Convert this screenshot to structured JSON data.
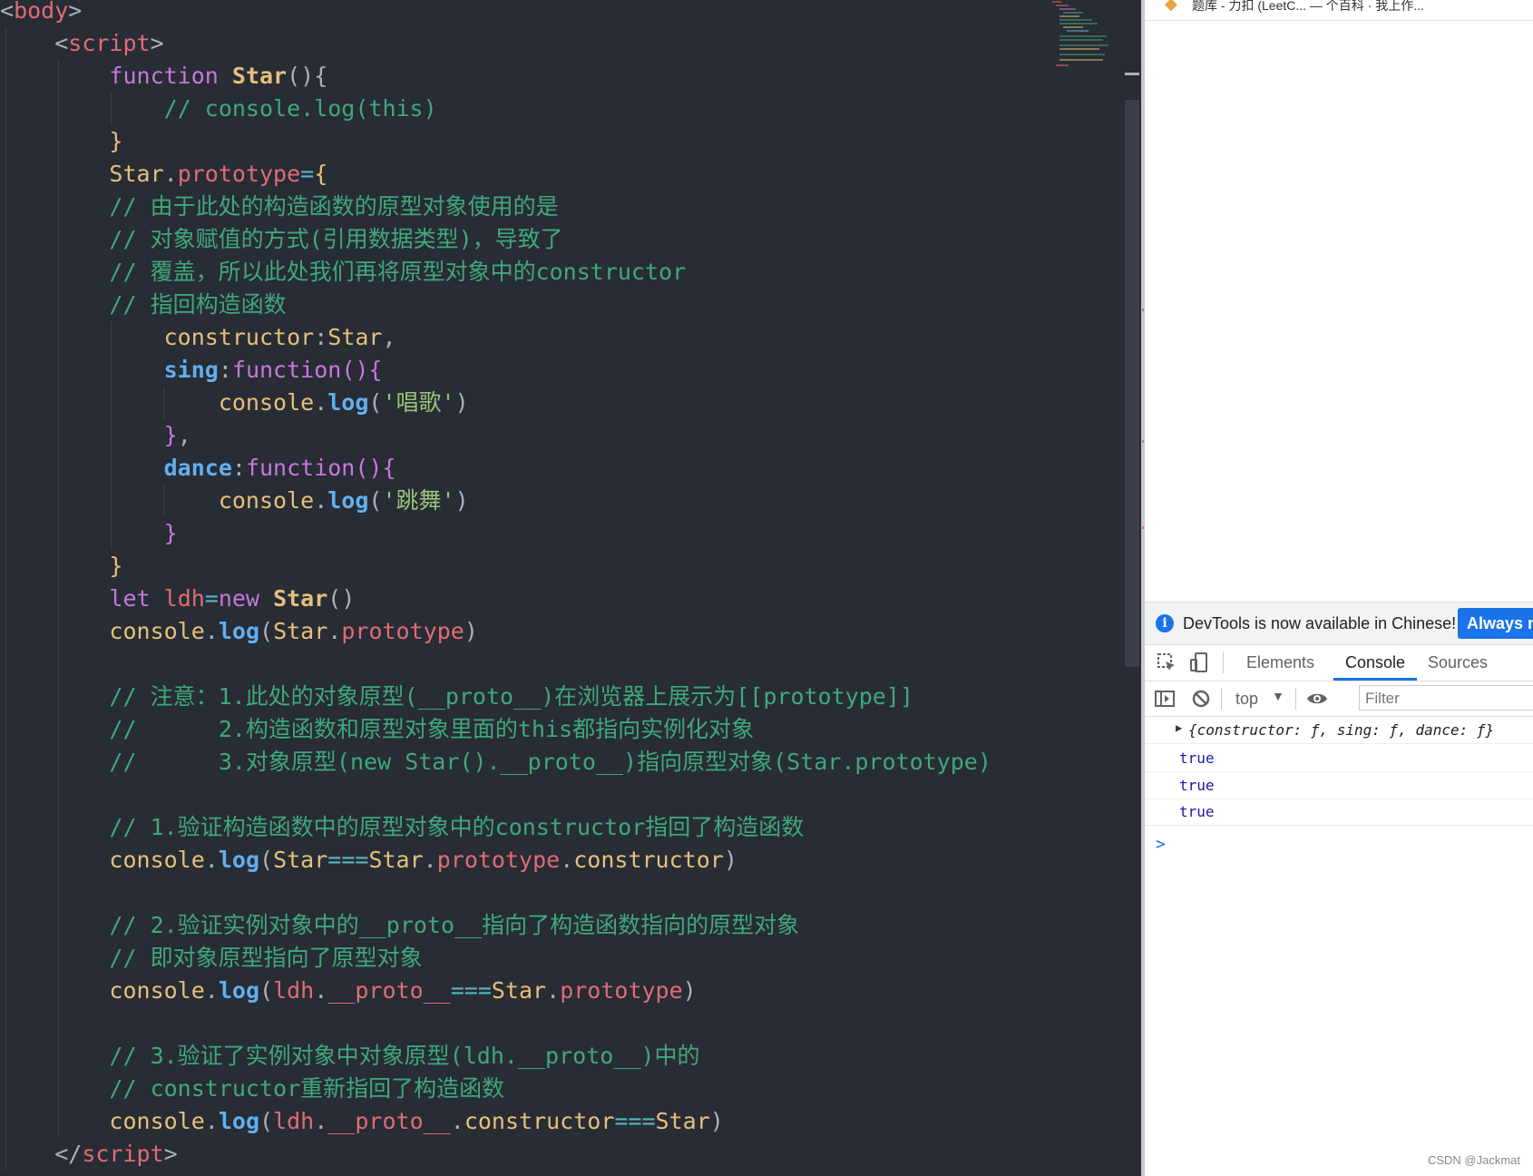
{
  "code_lines": [
    {
      "guides": [],
      "tokens": [
        [
          "t-punct",
          "<"
        ],
        [
          "t-tag",
          "body"
        ],
        [
          "t-punct",
          ">"
        ]
      ]
    },
    {
      "guides": [
        6
      ],
      "tokens": [
        [
          "t-plain",
          "    "
        ],
        [
          "t-punct",
          "<"
        ],
        [
          "t-tag",
          "script"
        ],
        [
          "t-punct",
          ">"
        ]
      ]
    },
    {
      "guides": [
        6,
        64
      ],
      "tokens": [
        [
          "t-plain",
          "        "
        ],
        [
          "t-kw",
          "function "
        ],
        [
          "t-fn",
          "Star"
        ],
        [
          "t-punct",
          "(){"
        ]
      ]
    },
    {
      "guides": [
        6,
        64,
        122
      ],
      "tokens": [
        [
          "t-plain",
          "            "
        ],
        [
          "t-com",
          "// console.log(this)"
        ]
      ]
    },
    {
      "guides": [
        6,
        64
      ],
      "tokens": [
        [
          "t-plain",
          "        "
        ],
        [
          "t-fld",
          "}"
        ]
      ]
    },
    {
      "guides": [
        6,
        64
      ],
      "tokens": [
        [
          "t-plain",
          "        "
        ],
        [
          "t-cls",
          "Star"
        ],
        [
          "t-punct",
          "."
        ],
        [
          "t-prop",
          "prototype"
        ],
        [
          "t-op",
          "="
        ],
        [
          "t-fld",
          "{"
        ]
      ]
    },
    {
      "guides": [
        6,
        64
      ],
      "tokens": [
        [
          "t-plain",
          "        "
        ],
        [
          "t-com",
          "// 由于此处的构造函数的原型对象使用的是"
        ]
      ]
    },
    {
      "guides": [
        6,
        64
      ],
      "tokens": [
        [
          "t-plain",
          "        "
        ],
        [
          "t-com",
          "// 对象赋值的方式(引用数据类型)，导致了"
        ]
      ]
    },
    {
      "guides": [
        6,
        64
      ],
      "tokens": [
        [
          "t-plain",
          "        "
        ],
        [
          "t-com",
          "// 覆盖，所以此处我们再将原型对象中的constructor"
        ]
      ]
    },
    {
      "guides": [
        6,
        64
      ],
      "tokens": [
        [
          "t-plain",
          "        "
        ],
        [
          "t-com",
          "// 指回构造函数"
        ]
      ]
    },
    {
      "guides": [
        6,
        64,
        122
      ],
      "tokens": [
        [
          "t-plain",
          "            "
        ],
        [
          "t-fld",
          "constructor"
        ],
        [
          "t-punct",
          ":"
        ],
        [
          "t-cls",
          "Star"
        ],
        [
          "t-punct",
          ","
        ]
      ]
    },
    {
      "guides": [
        6,
        64,
        122
      ],
      "tokens": [
        [
          "t-plain",
          "            "
        ],
        [
          "t-key",
          "sing"
        ],
        [
          "t-punct",
          ":"
        ],
        [
          "t-kw",
          "function"
        ],
        [
          "t-kw",
          "(){"
        ]
      ]
    },
    {
      "guides": [
        6,
        64,
        122,
        180
      ],
      "tokens": [
        [
          "t-plain",
          "                "
        ],
        [
          "t-cls",
          "console"
        ],
        [
          "t-punct",
          "."
        ],
        [
          "t-meth",
          "log"
        ],
        [
          "t-punct",
          "("
        ],
        [
          "t-str",
          "'唱歌'"
        ],
        [
          "t-punct",
          ")"
        ]
      ]
    },
    {
      "guides": [
        6,
        64,
        122
      ],
      "tokens": [
        [
          "t-plain",
          "            "
        ],
        [
          "t-kw",
          "}"
        ],
        [
          "t-punct",
          ","
        ]
      ]
    },
    {
      "guides": [
        6,
        64,
        122
      ],
      "tokens": [
        [
          "t-plain",
          "            "
        ],
        [
          "t-key",
          "dance"
        ],
        [
          "t-punct",
          ":"
        ],
        [
          "t-kw",
          "function"
        ],
        [
          "t-kw",
          "(){"
        ]
      ]
    },
    {
      "guides": [
        6,
        64,
        122,
        180
      ],
      "tokens": [
        [
          "t-plain",
          "                "
        ],
        [
          "t-cls",
          "console"
        ],
        [
          "t-punct",
          "."
        ],
        [
          "t-meth",
          "log"
        ],
        [
          "t-punct",
          "("
        ],
        [
          "t-str",
          "'跳舞'"
        ],
        [
          "t-punct",
          ")"
        ]
      ]
    },
    {
      "guides": [
        6,
        64,
        122
      ],
      "tokens": [
        [
          "t-plain",
          "            "
        ],
        [
          "t-kw",
          "}"
        ]
      ]
    },
    {
      "guides": [
        6,
        64
      ],
      "tokens": [
        [
          "t-plain",
          "        "
        ],
        [
          "t-fld",
          "}"
        ]
      ]
    },
    {
      "guides": [
        6,
        64
      ],
      "tokens": [
        [
          "t-plain",
          "        "
        ],
        [
          "t-kw",
          "let "
        ],
        [
          "t-var",
          "ldh"
        ],
        [
          "t-op",
          "="
        ],
        [
          "t-kw",
          "new "
        ],
        [
          "t-fn",
          "Star"
        ],
        [
          "t-punct",
          "()"
        ]
      ]
    },
    {
      "guides": [
        6,
        64
      ],
      "tokens": [
        [
          "t-plain",
          "        "
        ],
        [
          "t-cls",
          "console"
        ],
        [
          "t-punct",
          "."
        ],
        [
          "t-meth",
          "log"
        ],
        [
          "t-punct",
          "("
        ],
        [
          "t-cls",
          "Star"
        ],
        [
          "t-punct",
          "."
        ],
        [
          "t-prop",
          "prototype"
        ],
        [
          "t-punct",
          ")"
        ]
      ]
    },
    {
      "guides": [
        6,
        64
      ],
      "tokens": []
    },
    {
      "guides": [
        6,
        64
      ],
      "tokens": [
        [
          "t-plain",
          "        "
        ],
        [
          "t-com",
          "// 注意：1.此处的对象原型(__proto__)在浏览器上展示为[[prototype]]"
        ]
      ]
    },
    {
      "guides": [
        6,
        64
      ],
      "tokens": [
        [
          "t-plain",
          "        "
        ],
        [
          "t-com",
          "//      2.构造函数和原型对象里面的this都指向实例化对象"
        ]
      ]
    },
    {
      "guides": [
        6,
        64
      ],
      "tokens": [
        [
          "t-plain",
          "        "
        ],
        [
          "t-com",
          "//      3.对象原型(new Star().__proto__)指向原型对象(Star.prototype)"
        ]
      ]
    },
    {
      "guides": [
        6,
        64
      ],
      "tokens": []
    },
    {
      "guides": [
        6,
        64
      ],
      "tokens": [
        [
          "t-plain",
          "        "
        ],
        [
          "t-com",
          "// 1.验证构造函数中的原型对象中的constructor指回了构造函数"
        ]
      ]
    },
    {
      "guides": [
        6,
        64
      ],
      "tokens": [
        [
          "t-plain",
          "        "
        ],
        [
          "t-cls",
          "console"
        ],
        [
          "t-punct",
          "."
        ],
        [
          "t-meth",
          "log"
        ],
        [
          "t-punct",
          "("
        ],
        [
          "t-cls",
          "Star"
        ],
        [
          "t-op",
          "==="
        ],
        [
          "t-cls",
          "Star"
        ],
        [
          "t-punct",
          "."
        ],
        [
          "t-prop",
          "prototype"
        ],
        [
          "t-punct",
          "."
        ],
        [
          "t-fld",
          "constructor"
        ],
        [
          "t-punct",
          ")"
        ]
      ]
    },
    {
      "guides": [
        6,
        64
      ],
      "tokens": []
    },
    {
      "guides": [
        6,
        64
      ],
      "tokens": [
        [
          "t-plain",
          "        "
        ],
        [
          "t-com",
          "// 2.验证实例对象中的__proto__指向了构造函数指向的原型对象"
        ]
      ]
    },
    {
      "guides": [
        6,
        64
      ],
      "tokens": [
        [
          "t-plain",
          "        "
        ],
        [
          "t-com",
          "// 即对象原型指向了原型对象"
        ]
      ]
    },
    {
      "guides": [
        6,
        64
      ],
      "tokens": [
        [
          "t-plain",
          "        "
        ],
        [
          "t-cls",
          "console"
        ],
        [
          "t-punct",
          "."
        ],
        [
          "t-meth",
          "log"
        ],
        [
          "t-punct",
          "("
        ],
        [
          "t-var",
          "ldh"
        ],
        [
          "t-punct",
          "."
        ],
        [
          "t-prop",
          "__proto__"
        ],
        [
          "t-op",
          "==="
        ],
        [
          "t-cls",
          "Star"
        ],
        [
          "t-punct",
          "."
        ],
        [
          "t-prop",
          "prototype"
        ],
        [
          "t-punct",
          ")"
        ]
      ]
    },
    {
      "guides": [
        6,
        64
      ],
      "tokens": []
    },
    {
      "guides": [
        6,
        64
      ],
      "tokens": [
        [
          "t-plain",
          "        "
        ],
        [
          "t-com",
          "// 3.验证了实例对象中对象原型(ldh.__proto__)中的"
        ]
      ]
    },
    {
      "guides": [
        6,
        64
      ],
      "tokens": [
        [
          "t-plain",
          "        "
        ],
        [
          "t-com",
          "// constructor重新指回了构造函数"
        ]
      ]
    },
    {
      "guides": [
        6,
        64
      ],
      "tokens": [
        [
          "t-plain",
          "        "
        ],
        [
          "t-cls",
          "console"
        ],
        [
          "t-punct",
          "."
        ],
        [
          "t-meth",
          "log"
        ],
        [
          "t-punct",
          "("
        ],
        [
          "t-var",
          "ldh"
        ],
        [
          "t-punct",
          "."
        ],
        [
          "t-prop",
          "__proto__"
        ],
        [
          "t-punct",
          "."
        ],
        [
          "t-fld",
          "constructor"
        ],
        [
          "t-op",
          "==="
        ],
        [
          "t-cls",
          "Star"
        ],
        [
          "t-punct",
          ")"
        ]
      ]
    },
    {
      "guides": [
        6
      ],
      "tokens": [
        [
          "t-plain",
          "    "
        ],
        [
          "t-punct",
          "</"
        ],
        [
          "t-tag",
          "script"
        ],
        [
          "t-punct",
          ">"
        ]
      ]
    }
  ],
  "browser_tabs_partial": "题库 - 力扣 (LeetC...    — 个百科 · 我上作...",
  "banner": {
    "message": "DevTools is now available in Chinese!",
    "button": "Always m"
  },
  "devtools_tabs": [
    "Elements",
    "Console",
    "Sources"
  ],
  "toolbar": {
    "context": "top",
    "filter_placeholder": "Filter"
  },
  "console_rows": [
    {
      "kind": "object",
      "text": "{constructor: ƒ, sing: ƒ, dance: ƒ}"
    },
    {
      "kind": "bool",
      "text": "true"
    },
    {
      "kind": "bool",
      "text": "true"
    },
    {
      "kind": "bool",
      "text": "true"
    }
  ],
  "prompt_glyph": ">",
  "watermark": "CSDN @Jackmat"
}
